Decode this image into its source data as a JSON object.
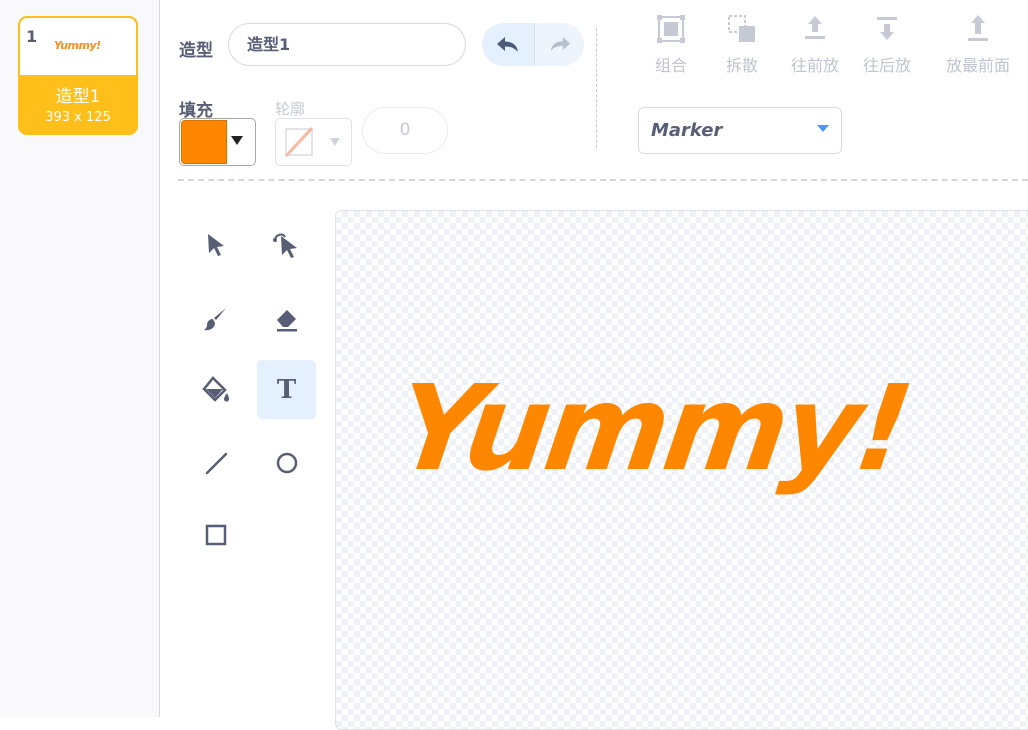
{
  "costume": {
    "number": "1",
    "name": "造型1",
    "size": "393 x 125",
    "thumb_text": "Yummy!"
  },
  "toolbar": {
    "costume_label": "造型",
    "costume_name_value": "造型1",
    "fill_label": "填充",
    "outline_label": "轮廓",
    "outline_width": "0",
    "fill_color": "#ff8700",
    "arrange": {
      "group": "组合",
      "ungroup": "拆散",
      "forward": "往前放",
      "backward": "往后放",
      "front": "放最前面"
    },
    "font": "Marker"
  },
  "tools": {
    "selected": "text"
  },
  "canvas": {
    "text": "Yummy!",
    "text_color": "#ff8700"
  }
}
